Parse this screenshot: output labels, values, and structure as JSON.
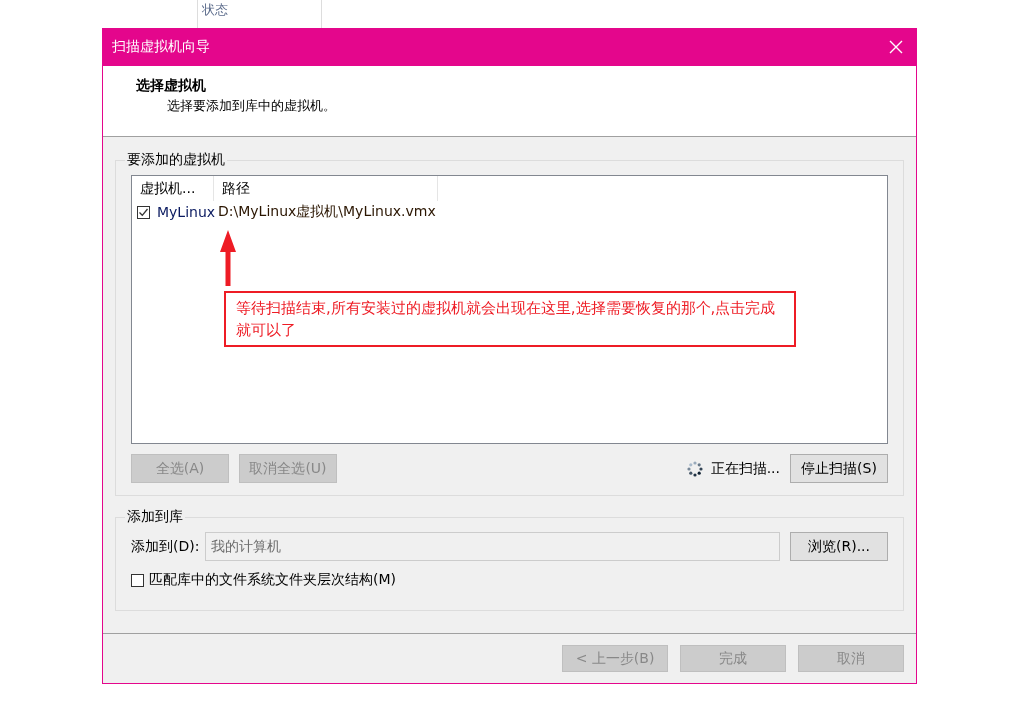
{
  "background_header": {
    "label": "状态"
  },
  "window": {
    "title": "扫描虚拟机向导"
  },
  "header": {
    "title": "选择虚拟机",
    "subtitle": "选择要添加到库中的虚拟机。"
  },
  "vm_group": {
    "title": "要添加的虚拟机",
    "columns": [
      "虚拟机...",
      "路径"
    ],
    "rows": [
      {
        "name": "MyLinux",
        "path": "D:\\MyLinux虚拟机\\MyLinux.vmx",
        "checked": true
      }
    ],
    "buttons": [
      {
        "label": "全选(A)",
        "disabled": true
      },
      {
        "label": "取消全选(U)",
        "disabled": true
      }
    ],
    "status": "正在扫描...",
    "stop_button": {
      "label": "停止扫描(S)",
      "disabled": false
    }
  },
  "library_group": {
    "title": "添加到库",
    "field_label": "添加到(D):",
    "field_value": "我的计算机",
    "browse_button": "浏览(R)...",
    "match_checkbox": {
      "label": "匹配库中的文件系统文件夹层次结构(M)",
      "checked": false
    }
  },
  "footer_buttons": [
    {
      "label": "< 上一步(B)",
      "disabled": true
    },
    {
      "label": "完成",
      "disabled": true
    },
    {
      "label": "取消",
      "disabled": true
    }
  ],
  "annotation": {
    "text": "等待扫描结束,所有安装过的虚拟机就会出现在这里,选择需要恢复的那个,点击完成就可以了"
  }
}
